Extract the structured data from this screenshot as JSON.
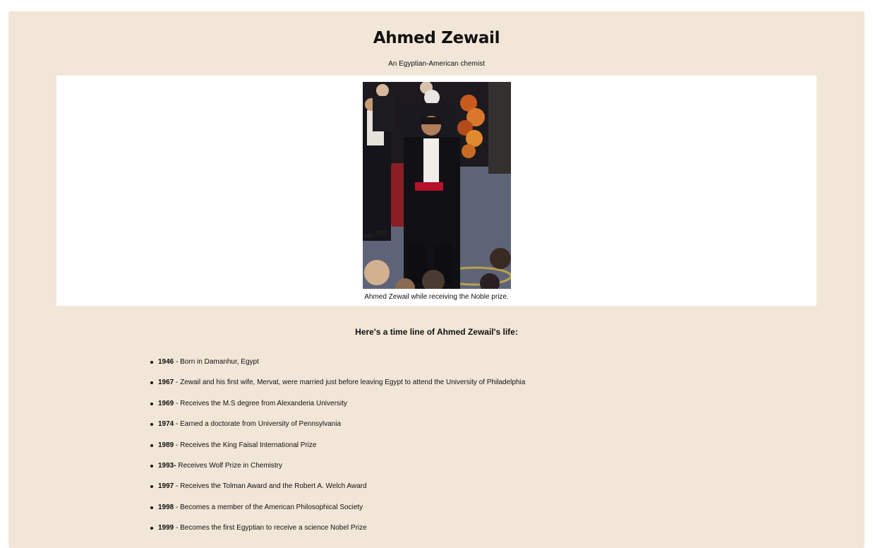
{
  "title": "Ahmed Zewail",
  "subtitle": "An Egyptian-American chemist",
  "image": {
    "caption": "Ahmed Zewail while receiving the Noble prize."
  },
  "timeline_heading": "Here's a time line of Ahmed Zewail's life:",
  "timeline": [
    {
      "year": "1946",
      "sep": " - ",
      "text": "Born in Damanhur, Egypt"
    },
    {
      "year": "1967",
      "sep": " - ",
      "text": "Zewail and his first wife, Mervat, were married just before leaving Egypt to attend the University of Philadelphia"
    },
    {
      "year": "1969",
      "sep": " - ",
      "text": "Receives the M.S degree from Alexanderia University"
    },
    {
      "year": "1974",
      "sep": " - ",
      "text": "Earned a doctorate from University of Pennsylvania"
    },
    {
      "year": "1989",
      "sep": " - ",
      "text": "Receives the King Faisal International Prize"
    },
    {
      "year": "1993-",
      "sep": " ",
      "text": "Receives Wolf Prize in Chemistry"
    },
    {
      "year": "1997",
      "sep": " - ",
      "text": "Receives the Tolman Award and the Robert A. Welch Award"
    },
    {
      "year": "1998",
      "sep": " - ",
      "text": "Becomes a member of the American Philosophical Society"
    },
    {
      "year": "1999",
      "sep": " - ",
      "text": "Becomes the first Egyptian to receive a science Nobel Prize"
    }
  ]
}
